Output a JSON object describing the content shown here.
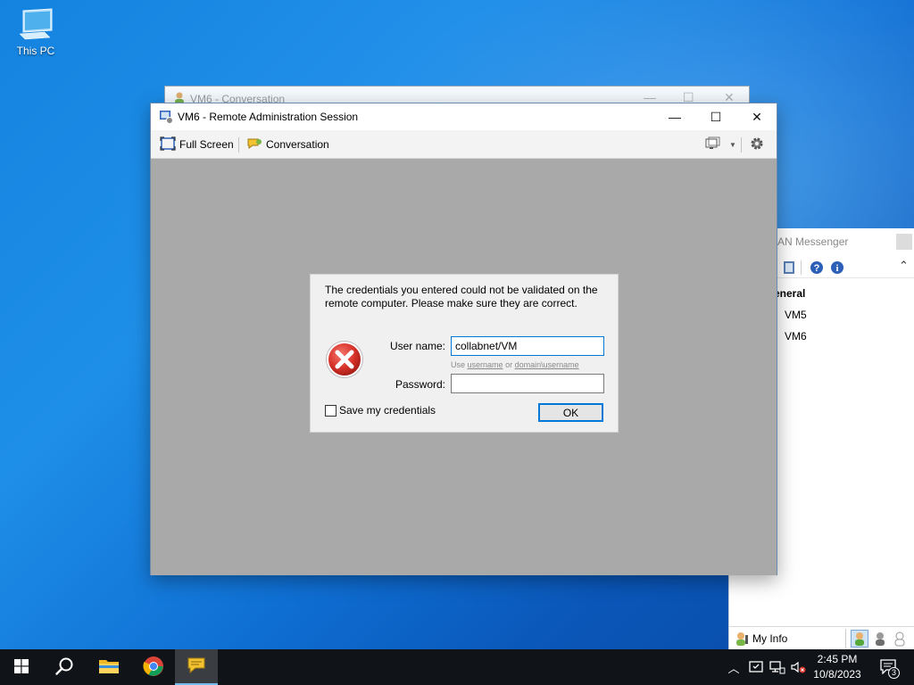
{
  "desktop": {
    "icon_label": "This PC"
  },
  "conversation_window": {
    "title": "VM6 - Conversation"
  },
  "messenger": {
    "title": "AN Messenger",
    "group": "eneral",
    "contacts": [
      "VM5",
      "VM6"
    ],
    "my_info": "My Info"
  },
  "ra_window": {
    "title": "VM6 - Remote Administration Session",
    "toolbar": {
      "full_screen": "Full Screen",
      "conversation": "Conversation"
    }
  },
  "credentials_dialog": {
    "message": "The credentials you entered could not be validated on the remote computer. Please make sure they are correct.",
    "username_label": "User name:",
    "username_value": "collabnet/VM",
    "hint_prefix": "Use",
    "hint_username": "username",
    "hint_or": "or",
    "hint_domain_username": "domain\\username",
    "password_label": "Password:",
    "password_value": "",
    "save_label": "Save my credentials",
    "save_checked": false,
    "ok_label": "OK"
  },
  "taskbar": {
    "time": "2:45 PM",
    "date": "10/8/2023",
    "notification_count": "3"
  },
  "colors": {
    "accent": "#0078d7",
    "taskbar": "#101318",
    "session_bg": "#a9a9a9",
    "error_red": "#d9342b"
  }
}
